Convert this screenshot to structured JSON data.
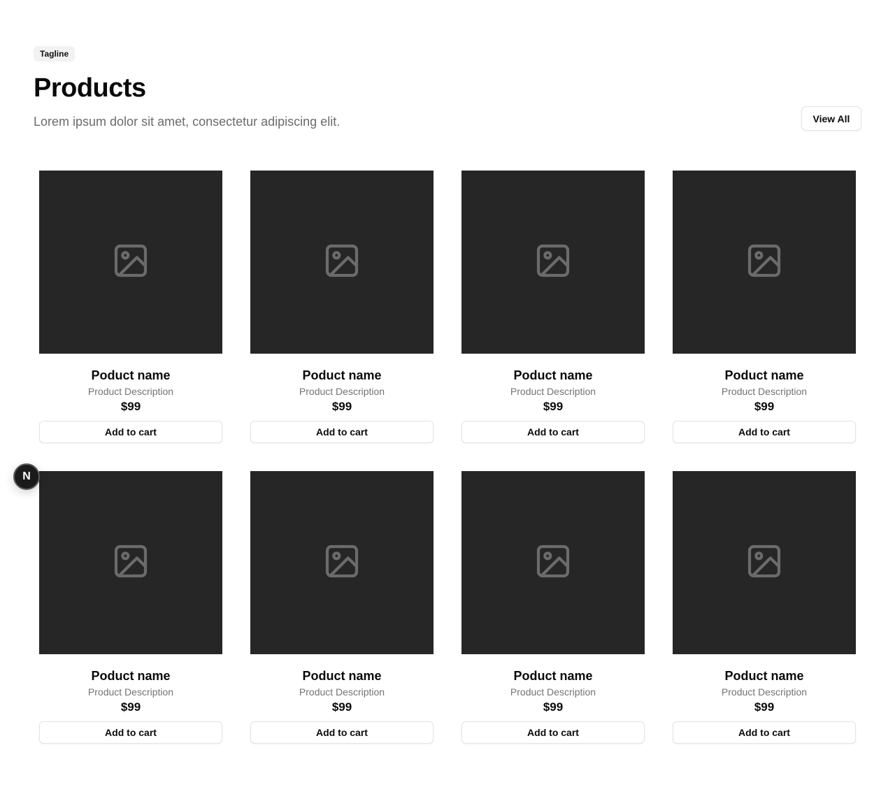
{
  "header": {
    "tagline": "Tagline",
    "title": "Products",
    "subtitle": "Lorem ipsum dolor sit amet, consectetur adipiscing elit.",
    "view_all_label": "View All"
  },
  "products": [
    {
      "name": "Poduct name",
      "description": "Product Description",
      "price": "$99",
      "button": "Add to cart",
      "icon": "image-placeholder-icon"
    },
    {
      "name": "Poduct name",
      "description": "Product Description",
      "price": "$99",
      "button": "Add to cart",
      "icon": "image-placeholder-icon"
    },
    {
      "name": "Poduct name",
      "description": "Product Description",
      "price": "$99",
      "button": "Add to cart",
      "icon": "image-placeholder-icon"
    },
    {
      "name": "Poduct name",
      "description": "Product Description",
      "price": "$99",
      "button": "Add to cart",
      "icon": "image-placeholder-icon"
    },
    {
      "name": "Poduct name",
      "description": "Product Description",
      "price": "$99",
      "button": "Add to cart",
      "icon": "image-placeholder-icon"
    },
    {
      "name": "Poduct name",
      "description": "Product Description",
      "price": "$99",
      "button": "Add to cart",
      "icon": "image-placeholder-icon"
    },
    {
      "name": "Poduct name",
      "description": "Product Description",
      "price": "$99",
      "button": "Add to cart",
      "icon": "image-placeholder-icon"
    },
    {
      "name": "Poduct name",
      "description": "Product Description",
      "price": "$99",
      "button": "Add to cart",
      "icon": "image-placeholder-icon"
    }
  ],
  "dev_badge": {
    "label": "N",
    "icon": "nextjs-logo-icon"
  },
  "colors": {
    "image_bg": "#262626",
    "placeholder_icon": "#6b6b6b",
    "text_primary": "#0a0a0a",
    "text_muted": "#737373",
    "border": "#e3e3e3",
    "tagline_bg": "#f2f2f2"
  }
}
